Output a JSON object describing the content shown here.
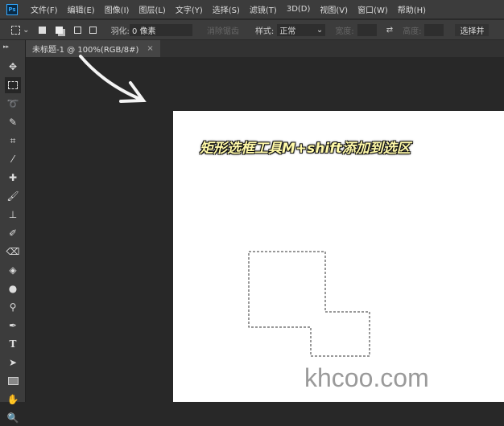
{
  "menubar": {
    "app_icon": "Ps",
    "items": [
      "文件(F)",
      "编辑(E)",
      "图像(I)",
      "图层(L)",
      "文字(Y)",
      "选择(S)",
      "滤镜(T)",
      "3D(D)",
      "视图(V)",
      "窗口(W)",
      "帮助(H)"
    ]
  },
  "options": {
    "feather_label": "羽化:",
    "feather_value": "0 像素",
    "antialias": "消除锯齿",
    "style_label": "样式:",
    "style_value": "正常",
    "width_label": "宽度:",
    "height_label": "高度:",
    "select_mask": "选择并"
  },
  "tab": {
    "title": "未标题-1 @ 100%(RGB/8#)",
    "close": "×"
  },
  "tools": [
    "move",
    "rect-marquee",
    "lasso",
    "quick-select",
    "crop",
    "eyedropper",
    "healing",
    "brush",
    "stamp",
    "history-brush",
    "eraser",
    "paint-bucket",
    "blur",
    "dodge",
    "pen",
    "type",
    "path-select",
    "rectangle",
    "hand",
    "zoom"
  ],
  "caption": "矩形选框工具M+shift添加到选区",
  "watermark": "khcoo.com"
}
